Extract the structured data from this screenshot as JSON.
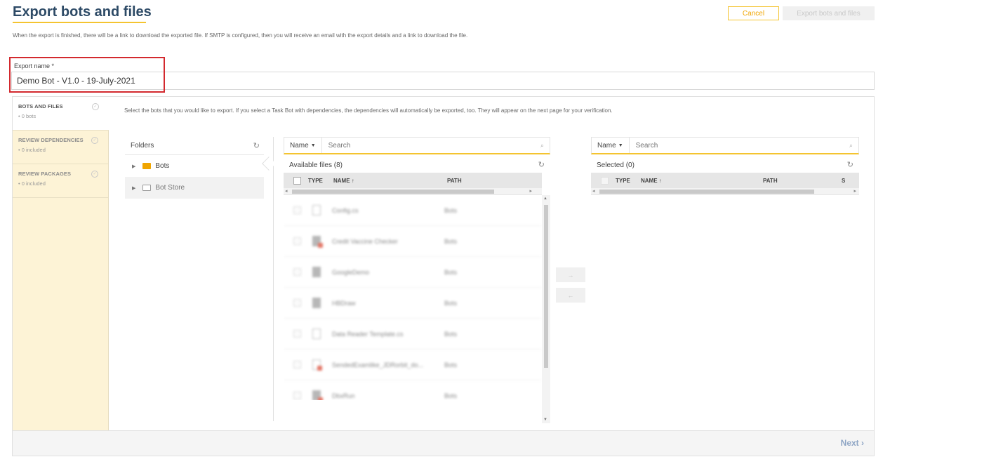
{
  "header": {
    "title": "Export bots and files",
    "description": "When the export is finished, there will be a link to download the exported file. If SMTP is configured, then you will receive an email with the export details and a link to download the file.",
    "cancel_label": "Cancel",
    "export_label": "Export bots and files"
  },
  "export_name": {
    "label": "Export name *",
    "value": "Demo Bot - V1.0 - 19-July-2021"
  },
  "steps": [
    {
      "title": "BOTS AND FILES",
      "sub": "• 0 bots"
    },
    {
      "title": "REVIEW DEPENDENCIES",
      "sub": "• 0 included"
    },
    {
      "title": "REVIEW PACKAGES",
      "sub": "• 0 included"
    }
  ],
  "instructions": "Select the bots that you would like to export. If you select a Task Bot with dependencies, the dependencies will automatically be exported, too. They will appear on the next page for your verification.",
  "folders": {
    "title": "Folders",
    "items": [
      {
        "label": "Bots"
      },
      {
        "label": "Bot Store"
      }
    ]
  },
  "available": {
    "name_dropdown": "Name",
    "search_placeholder": "Search",
    "title": "Available files (8)",
    "columns": {
      "type": "TYPE",
      "name": "NAME ↑",
      "path": "PATH"
    },
    "files": [
      {
        "name": "Config.cs",
        "path": "Bots",
        "icon": "doc"
      },
      {
        "name": "Credit Vaccine Checker",
        "path": "Bots",
        "icon": "bot-red"
      },
      {
        "name": "GoogleDemo",
        "path": "Bots",
        "icon": "bot"
      },
      {
        "name": "HBDraw",
        "path": "Bots",
        "icon": "bot"
      },
      {
        "name": "Data Reader Template.cs",
        "path": "Bots",
        "icon": "doc"
      },
      {
        "name": "SendedExamlike_JDRorbit_do...",
        "path": "Bots",
        "icon": "doc-red"
      },
      {
        "name": "DbxRun",
        "path": "Bots",
        "icon": "bot-red"
      }
    ]
  },
  "selected": {
    "name_dropdown": "Name",
    "search_placeholder": "Search",
    "title": "Selected (0)",
    "columns": {
      "type": "TYPE",
      "name": "NAME ↑",
      "path": "PATH",
      "extra": "S"
    }
  },
  "move": {
    "add": "→",
    "remove": "←"
  },
  "footer": {
    "next_label": "Next ›"
  },
  "icons": {
    "check": "check-circle-icon",
    "refresh": "refresh-icon",
    "search": "search-icon",
    "folder": "folder-icon"
  },
  "colors": {
    "accent": "#f4c430",
    "title": "#2d4a66",
    "highlight": "#d3292e",
    "step_bg": "#fdf3d6"
  }
}
